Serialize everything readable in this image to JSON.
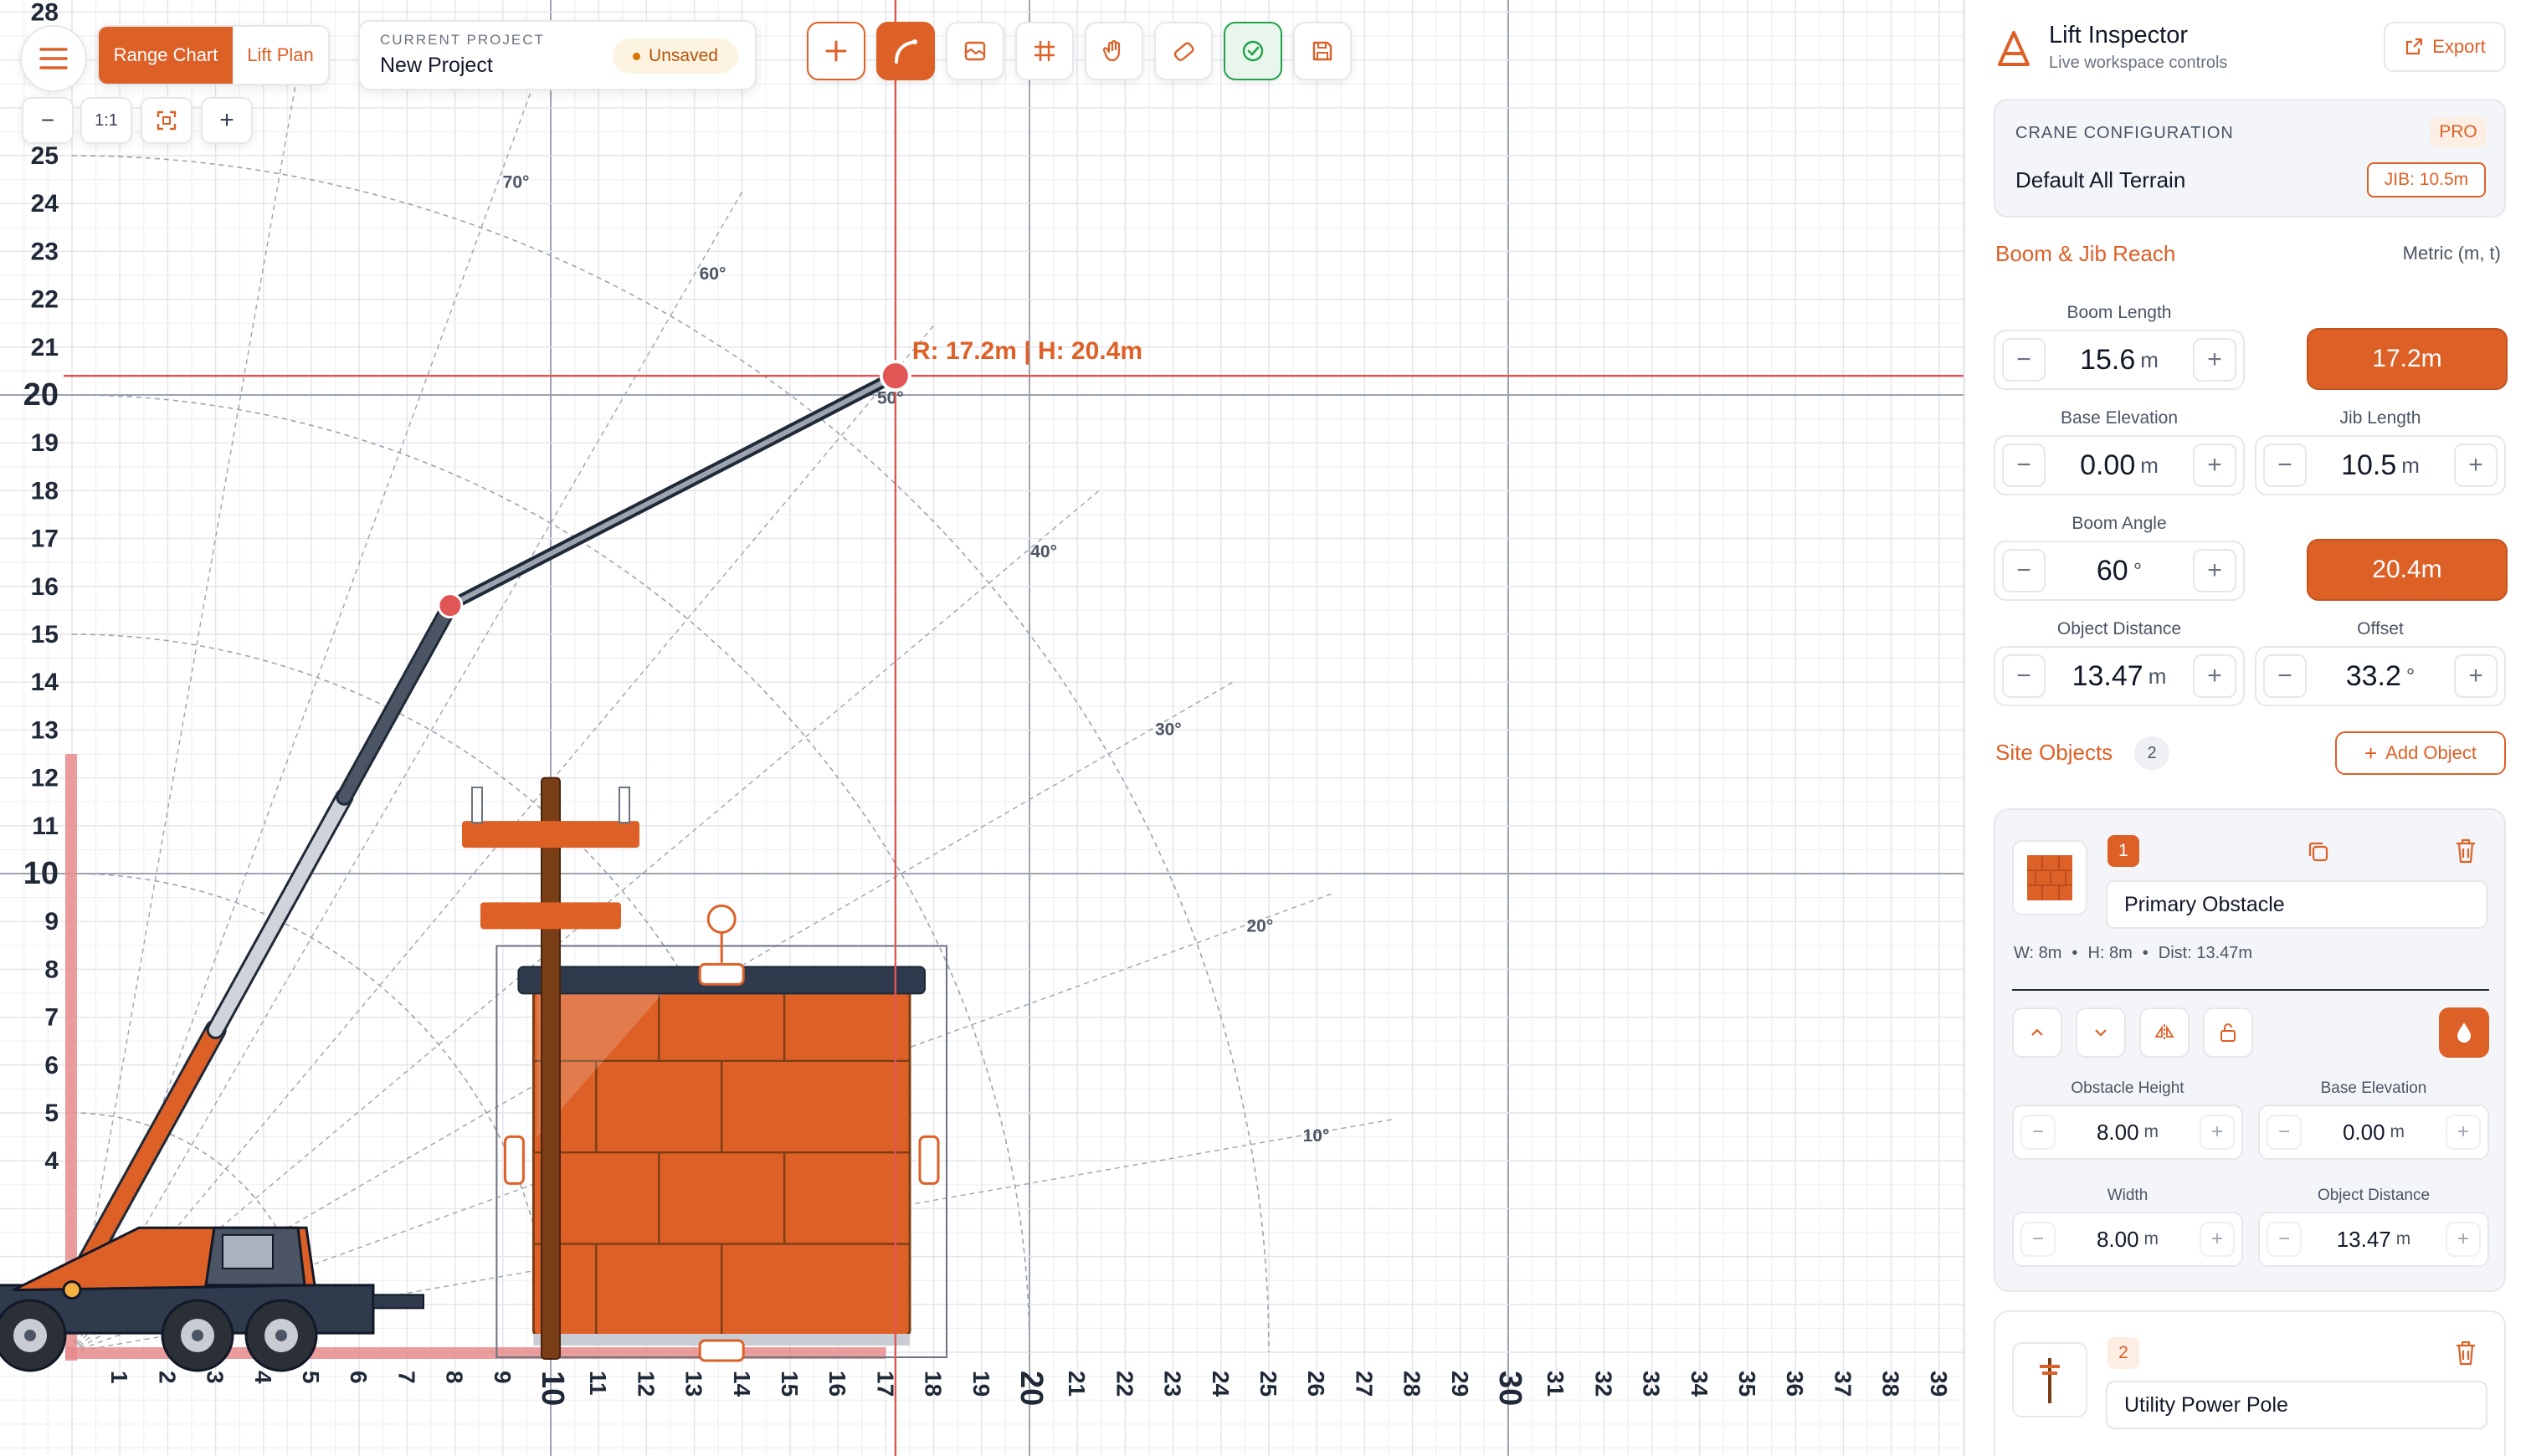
{
  "toolbar": {
    "menu_icon": "menu-icon",
    "view_tabs": [
      "Range Chart",
      "Lift Plan"
    ],
    "active_tab": "Range Chart",
    "zoom": {
      "out": "−",
      "reset": "1:1",
      "fit_icon": "fit-screen-icon",
      "in": "+"
    },
    "project": {
      "caption": "CURRENT PROJECT",
      "name": "New Project",
      "status": "Unsaved"
    },
    "tools": [
      "add-icon",
      "boom-draw-icon",
      "image-icon",
      "grid-icon",
      "hand-icon",
      "eraser-icon",
      "check-icon",
      "save-icon"
    ],
    "active_tool": "boom-draw-icon"
  },
  "chart_data": {
    "type": "range-chart",
    "x_axis": {
      "min": 1,
      "max": 39,
      "bold_ticks": [
        10,
        20,
        30
      ]
    },
    "y_axis": {
      "min": 4,
      "max": 28,
      "bold_ticks": [
        10,
        20
      ]
    },
    "angle_labels": [
      "10°",
      "20°",
      "30°",
      "40°",
      "50°",
      "60°",
      "70°"
    ],
    "boom_tip": {
      "label": "R: 17.2m | H: 20.4m",
      "radius": 17.2,
      "height": 20.4
    },
    "objects": [
      {
        "name": "Primary Obstacle",
        "kind": "brick-wall",
        "width": 8,
        "height": 8,
        "distance": 13.47
      },
      {
        "name": "Utility Power Pole",
        "kind": "pole"
      }
    ]
  },
  "inspector": {
    "title": "Lift Inspector",
    "subtitle": "Live workspace controls",
    "export_label": "Export",
    "crane_config": {
      "caption": "CRANE CONFIGURATION",
      "badge": "PRO",
      "name": "Default All Terrain",
      "jib_badge": "JIB: 10.5m"
    },
    "reach": {
      "title": "Boom & Jib Reach",
      "units": "Metric (m, t)",
      "boom_length": {
        "label": "Boom Length",
        "value": "15.6",
        "unit": "m",
        "result": "17.2m"
      },
      "base_elevation": {
        "label": "Base Elevation",
        "value": "0.00",
        "unit": "m"
      },
      "jib_length": {
        "label": "Jib Length",
        "value": "10.5",
        "unit": "m"
      },
      "boom_angle": {
        "label": "Boom Angle",
        "value": "60",
        "unit": "°",
        "result": "20.4m"
      },
      "object_distance": {
        "label": "Object Distance",
        "value": "13.47",
        "unit": "m"
      },
      "offset": {
        "label": "Offset",
        "value": "33.2",
        "unit": "°"
      }
    },
    "site_objects": {
      "title": "Site Objects",
      "count": "2",
      "add_label": "Add Object",
      "items": [
        {
          "index": "1",
          "name": "Primary Obstacle",
          "meta": [
            "W: 8m",
            "H: 8m",
            "Dist: 13.47m"
          ],
          "obstacle_height": {
            "label": "Obstacle Height",
            "value": "8.00",
            "unit": "m"
          },
          "base_elevation": {
            "label": "Base Elevation",
            "value": "0.00",
            "unit": "m"
          },
          "width": {
            "label": "Width",
            "value": "8.00",
            "unit": "m"
          },
          "object_distance": {
            "label": "Object Distance",
            "value": "13.47",
            "unit": "m"
          }
        },
        {
          "index": "2",
          "name": "Utility Power Pole"
        }
      ]
    }
  },
  "colors": {
    "accent": "#dd6027",
    "accent_dark": "#c4521d",
    "guide_red": "#e25555",
    "boom_dark": "#4b5563",
    "grid": "#e5e7eb"
  }
}
